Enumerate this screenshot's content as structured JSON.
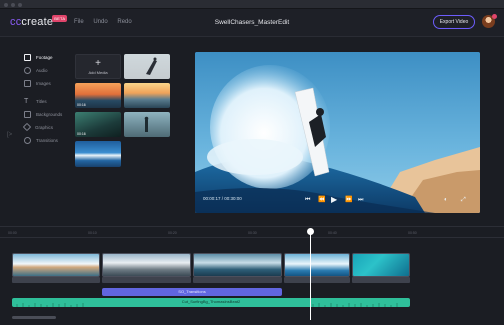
{
  "app": {
    "logo_prefix": "cc",
    "logo_suffix": "create",
    "badge": "BETA",
    "menu": [
      "File",
      "Undo",
      "Redo"
    ],
    "project_title": "SwellChasers_MasterEdit",
    "export_label": "Export Video"
  },
  "sidebar": {
    "items": [
      {
        "label": "Footage",
        "icon": "film-icon",
        "active": true
      },
      {
        "label": "Audio",
        "icon": "music-icon",
        "active": false
      },
      {
        "label": "Images",
        "icon": "image-icon",
        "active": false
      },
      {
        "label": "Titles",
        "icon": "text-icon",
        "active": false
      },
      {
        "label": "Backgrounds",
        "icon": "background-icon",
        "active": false
      },
      {
        "label": "Graphics",
        "icon": "graphics-icon",
        "active": false
      },
      {
        "label": "Transitions",
        "icon": "transition-icon",
        "active": false
      }
    ]
  },
  "media": {
    "add_label": "Add Media",
    "durations": [
      "",
      "00:16",
      "",
      "00:16",
      ""
    ]
  },
  "player": {
    "time": "00:00:17 / 00:30:00"
  },
  "timeline": {
    "text_clip": "SO_Transitions",
    "audio_clip": "Cut_SurfingBg_ThomasInsBeat2"
  },
  "colors": {
    "accent": "#6d5dfc",
    "audio": "#2fbf9a",
    "text_track": "#6166e0",
    "badge": "#e0456b"
  }
}
